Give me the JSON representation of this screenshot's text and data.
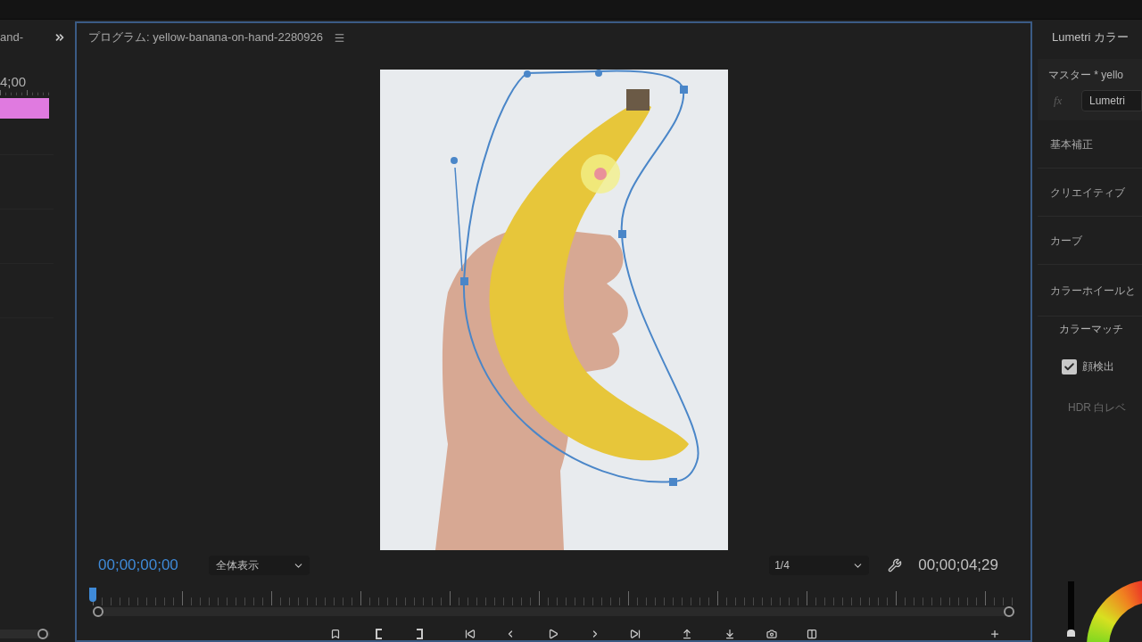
{
  "timeline_panel": {
    "tab_label": "and-",
    "timecode": "4;00"
  },
  "program_monitor": {
    "title": "プログラム: yellow-banana-on-hand-2280926",
    "current_timecode": "00;00;00;00",
    "zoom_dropdown": {
      "value": "全体表示"
    },
    "resolution_dropdown": {
      "value": "1/4"
    },
    "duration_timecode": "00;00;04;29",
    "playhead": {
      "level": 0
    }
  },
  "lumetri_panel": {
    "title": "Lumetri カラー",
    "clip_label": "マスター * yello",
    "fx_label": "fx",
    "effect_dropdown": {
      "value": "Lumetri"
    },
    "sections": [
      {
        "label": "基本補正"
      },
      {
        "label": "クリエイティブ"
      },
      {
        "label": "カーブ"
      },
      {
        "label": "カラーホイールと"
      }
    ],
    "color_match": {
      "label": "カラーマッチ",
      "face_detection": {
        "label": "顔検出",
        "checked": true
      },
      "hdr_white_level": {
        "label": "HDR 白レベ",
        "disabled": true
      }
    },
    "wheel_slider": {
      "level": 0
    }
  }
}
